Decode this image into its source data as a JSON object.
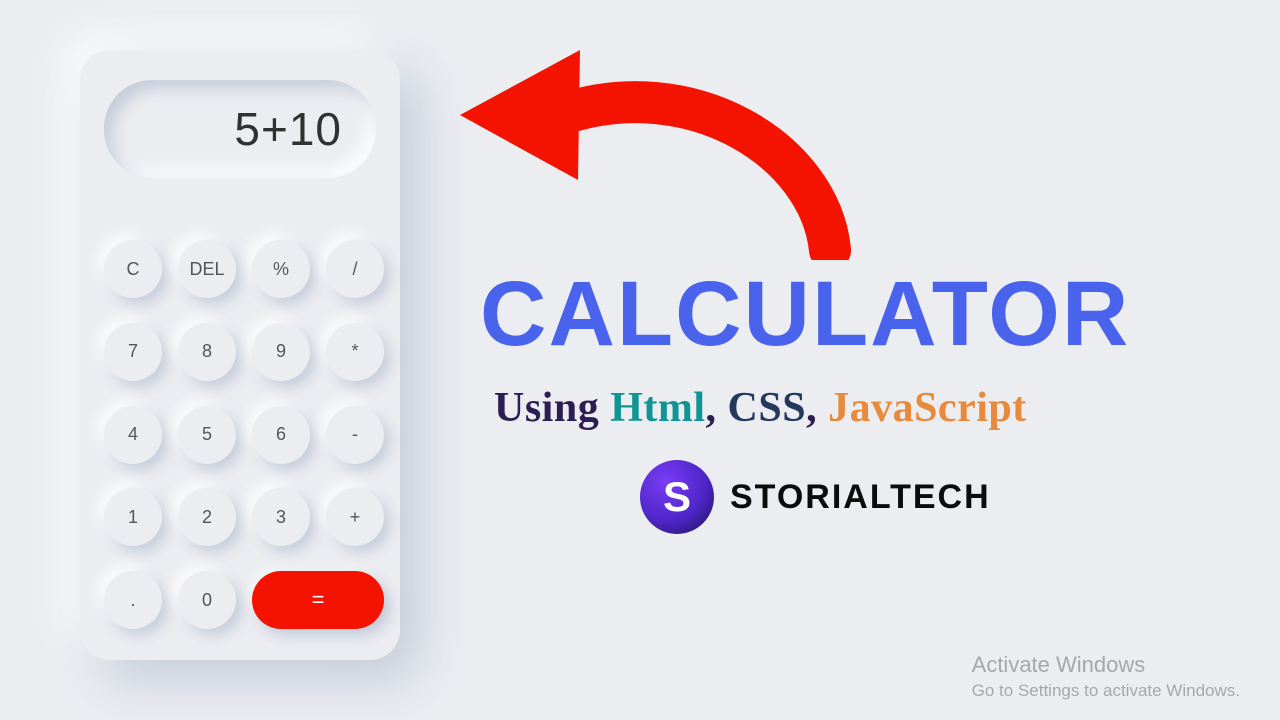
{
  "calculator": {
    "display_value": "5+10",
    "keys": [
      {
        "id": "clear",
        "label": "C"
      },
      {
        "id": "delete",
        "label": "DEL"
      },
      {
        "id": "percent",
        "label": "%"
      },
      {
        "id": "divide",
        "label": "/"
      },
      {
        "id": "seven",
        "label": "7"
      },
      {
        "id": "eight",
        "label": "8"
      },
      {
        "id": "nine",
        "label": "9"
      },
      {
        "id": "multiply",
        "label": "*"
      },
      {
        "id": "four",
        "label": "4"
      },
      {
        "id": "five",
        "label": "5"
      },
      {
        "id": "six",
        "label": "6"
      },
      {
        "id": "minus",
        "label": "-"
      },
      {
        "id": "one",
        "label": "1"
      },
      {
        "id": "two",
        "label": "2"
      },
      {
        "id": "three",
        "label": "3"
      },
      {
        "id": "plus",
        "label": "+"
      },
      {
        "id": "dot",
        "label": "."
      },
      {
        "id": "zero",
        "label": "0"
      }
    ],
    "equals_label": "="
  },
  "headline": "CALCULATOR",
  "subtitle": {
    "using": "Using",
    "html": "Html",
    "css": "CSS",
    "js": "JavaScript",
    "comma": ","
  },
  "brand": {
    "badge_letter": "S",
    "name": "STORIALTECH"
  },
  "watermark": {
    "line1": "Activate Windows",
    "line2": "Go to Settings to activate Windows."
  },
  "colors": {
    "accent_red": "#f41300",
    "headline_blue": "#4a63ec"
  }
}
